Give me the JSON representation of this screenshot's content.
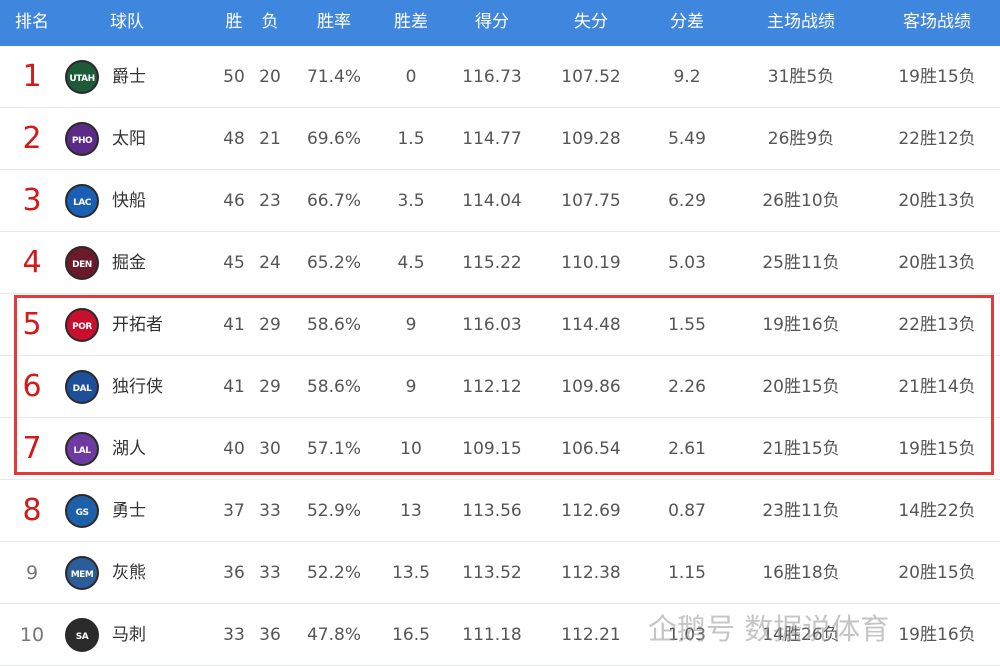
{
  "header": {
    "rank": "排名",
    "team": "球队",
    "wins": "胜",
    "losses": "负",
    "win_pct": "胜率",
    "games_behind": "胜差",
    "points_for": "得分",
    "points_against": "失分",
    "point_diff": "分差",
    "home": "主场战绩",
    "away": "客场战绩"
  },
  "rows": [
    {
      "rank": "1",
      "logo": "UTAH",
      "team": "爵士",
      "wins": "50",
      "losses": "20",
      "pct": "71.4%",
      "gb": "0",
      "pf": "116.73",
      "pa": "107.52",
      "diff": "9.2",
      "home": "31胜5负",
      "away": "19胜15负",
      "color": "#1d5a3a"
    },
    {
      "rank": "2",
      "logo": "PHO",
      "team": "太阳",
      "wins": "48",
      "losses": "21",
      "pct": "69.6%",
      "gb": "1.5",
      "pf": "114.77",
      "pa": "109.28",
      "diff": "5.49",
      "home": "26胜9负",
      "away": "22胜12负",
      "color": "#5b2a86"
    },
    {
      "rank": "3",
      "logo": "LAC",
      "team": "快船",
      "wins": "46",
      "losses": "23",
      "pct": "66.7%",
      "gb": "3.5",
      "pf": "114.04",
      "pa": "107.75",
      "diff": "6.29",
      "home": "26胜10负",
      "away": "20胜13负",
      "color": "#1a5fb4"
    },
    {
      "rank": "4",
      "logo": "DEN",
      "team": "掘金",
      "wins": "45",
      "losses": "24",
      "pct": "65.2%",
      "gb": "4.5",
      "pf": "115.22",
      "pa": "110.19",
      "diff": "5.03",
      "home": "25胜11负",
      "away": "20胜13负",
      "color": "#6a1a2a"
    },
    {
      "rank": "5",
      "logo": "POR",
      "team": "开拓者",
      "wins": "41",
      "losses": "29",
      "pct": "58.6%",
      "gb": "9",
      "pf": "116.03",
      "pa": "114.48",
      "diff": "1.55",
      "home": "19胜16负",
      "away": "22胜13负",
      "color": "#c8102e"
    },
    {
      "rank": "6",
      "logo": "DAL",
      "team": "独行侠",
      "wins": "41",
      "losses": "29",
      "pct": "58.6%",
      "gb": "9",
      "pf": "112.12",
      "pa": "109.86",
      "diff": "2.26",
      "home": "20胜15负",
      "away": "21胜14负",
      "color": "#1d4f9a"
    },
    {
      "rank": "7",
      "logo": "LAL",
      "team": "湖人",
      "wins": "40",
      "losses": "30",
      "pct": "57.1%",
      "gb": "10",
      "pf": "109.15",
      "pa": "106.54",
      "diff": "2.61",
      "home": "21胜15负",
      "away": "19胜15负",
      "color": "#6c3aa0"
    },
    {
      "rank": "8",
      "logo": "GS",
      "team": "勇士",
      "wins": "37",
      "losses": "33",
      "pct": "52.9%",
      "gb": "13",
      "pf": "113.56",
      "pa": "112.69",
      "diff": "0.87",
      "home": "23胜11负",
      "away": "14胜22负",
      "color": "#1d5fa8"
    },
    {
      "rank": "9",
      "logo": "MEM",
      "team": "灰熊",
      "wins": "36",
      "losses": "33",
      "pct": "52.2%",
      "gb": "13.5",
      "pf": "113.52",
      "pa": "112.38",
      "diff": "1.15",
      "home": "16胜18负",
      "away": "20胜15负",
      "color": "#2a5d9a"
    },
    {
      "rank": "10",
      "logo": "SA",
      "team": "马刺",
      "wins": "33",
      "losses": "36",
      "pct": "47.8%",
      "gb": "16.5",
      "pf": "111.18",
      "pa": "112.21",
      "diff": "1.03",
      "home": "14胜26负",
      "away": "19胜16负",
      "color": "#2b2b2b"
    }
  ],
  "watermark": "企鹅号 数据说体育",
  "highlight_color": "#e53a3a",
  "header_color": "#3f86df",
  "rank_color": "#d21a1a"
}
